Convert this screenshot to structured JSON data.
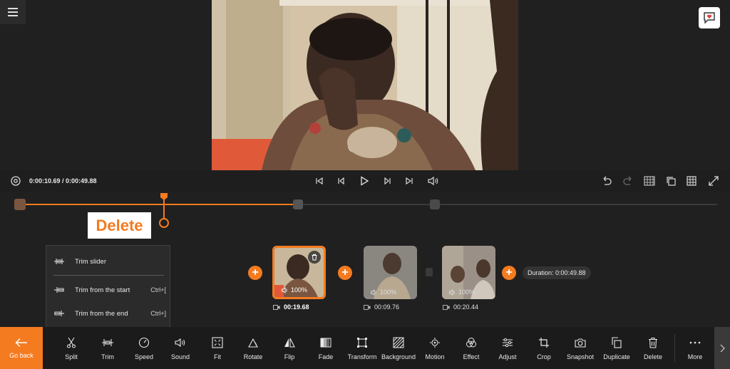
{
  "player": {
    "timecode": "0:00:10.69 / 0:00:49.88"
  },
  "overlay": {
    "delete_label": "Delete"
  },
  "trim_menu": {
    "items": [
      {
        "label": "Trim slider",
        "shortcut": ""
      },
      {
        "label": "Trim from the start",
        "shortcut": "Ctrl+["
      },
      {
        "label": "Trim from the end",
        "shortcut": "Ctrl+]"
      }
    ]
  },
  "clips": [
    {
      "volume": "100%",
      "duration": "00:19.68",
      "selected": true
    },
    {
      "volume": "100%",
      "duration": "00:09.76",
      "selected": false
    },
    {
      "volume": "100%",
      "duration": "00:20.44",
      "selected": false
    }
  ],
  "total_duration": "Duration: 0:00:49.88",
  "toolbar": {
    "go_back": "Go back",
    "tools": [
      "Split",
      "Trim",
      "Speed",
      "Sound",
      "Fit",
      "Rotate",
      "Flip",
      "Fade",
      "Transform",
      "Background",
      "Motion",
      "Effect",
      "Adjust",
      "Crop",
      "Snapshot",
      "Duplicate",
      "Delete",
      "More"
    ]
  },
  "colors": {
    "accent": "#f47b20",
    "background": "#202020",
    "toolbar": "#1b1b1b"
  }
}
